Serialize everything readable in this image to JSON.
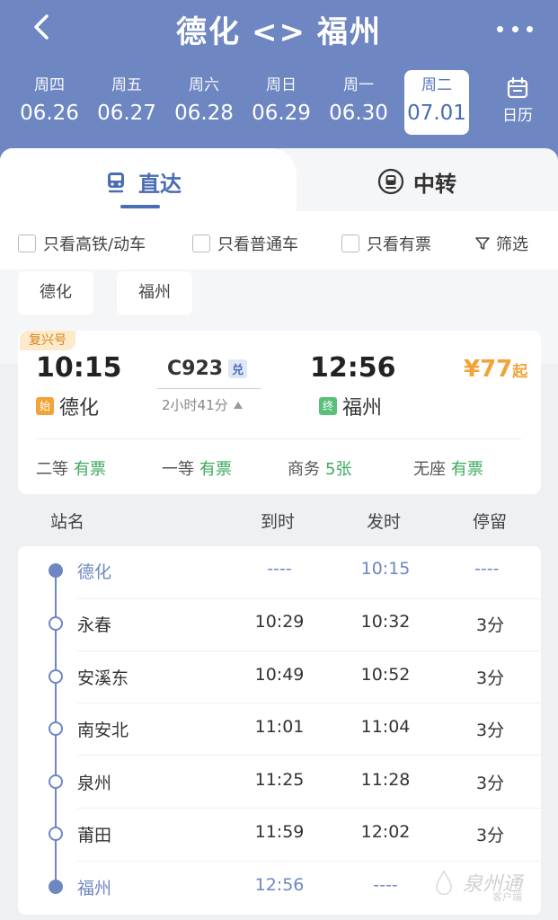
{
  "header": {
    "origin": "德化",
    "separator": "<>",
    "destination": "福州",
    "calendar_label": "日历",
    "dates": [
      {
        "weekday": "周四",
        "date": "06.26"
      },
      {
        "weekday": "周五",
        "date": "06.27"
      },
      {
        "weekday": "周六",
        "date": "06.28"
      },
      {
        "weekday": "周日",
        "date": "06.29"
      },
      {
        "weekday": "周一",
        "date": "06.30"
      },
      {
        "weekday": "周二",
        "date": "07.01"
      }
    ],
    "selected_date_index": 5
  },
  "tabs": {
    "direct": "直达",
    "transfer": "中转",
    "active": "direct"
  },
  "filters": {
    "high_speed": "只看高铁/动车",
    "regular": "只看普通车",
    "available": "只看有票",
    "screen": "筛选"
  },
  "station_chips": [
    "德化",
    "福州"
  ],
  "train": {
    "type": "复兴号",
    "number": "C923",
    "exchange_badge": "兑",
    "departure_time": "10:15",
    "arrival_time": "12:56",
    "start_tag": "始",
    "end_tag": "终",
    "from_station": "德化",
    "to_station": "福州",
    "duration": "2小时41分",
    "price": "¥77",
    "price_suffix": "起",
    "seats": [
      {
        "class": "二等",
        "status": "有票"
      },
      {
        "class": "一等",
        "status": "有票"
      },
      {
        "class": "商务",
        "status": "5张"
      },
      {
        "class": "无座",
        "status": "有票"
      }
    ]
  },
  "stops_header": {
    "station": "站名",
    "arrive": "到时",
    "depart": "发时",
    "stay": "停留"
  },
  "stops": [
    {
      "name": "德化",
      "arrive": "----",
      "depart": "10:15",
      "stay": "----"
    },
    {
      "name": "永春",
      "arrive": "10:29",
      "depart": "10:32",
      "stay": "3分"
    },
    {
      "name": "安溪东",
      "arrive": "10:49",
      "depart": "10:52",
      "stay": "3分"
    },
    {
      "name": "南安北",
      "arrive": "11:01",
      "depart": "11:04",
      "stay": "3分"
    },
    {
      "name": "泉州",
      "arrive": "11:25",
      "depart": "11:28",
      "stay": "3分"
    },
    {
      "name": "莆田",
      "arrive": "11:59",
      "depart": "12:02",
      "stay": "3分"
    },
    {
      "name": "福州",
      "arrive": "12:56",
      "depart": "----",
      "stay": ""
    }
  ],
  "watermark": {
    "title": "泉州通",
    "subtitle": "客户端"
  }
}
